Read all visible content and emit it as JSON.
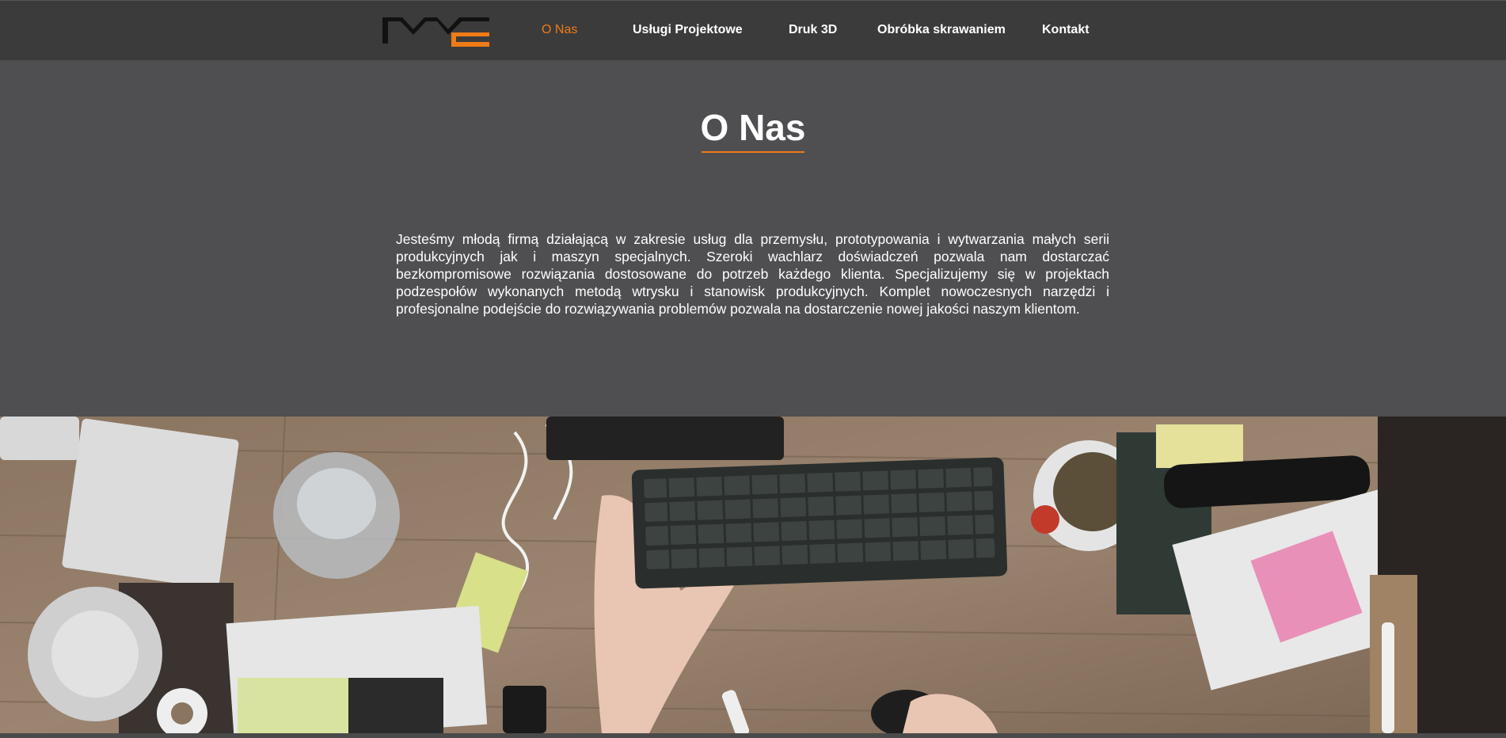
{
  "nav": {
    "logo_name": "MME-logo",
    "items": [
      {
        "label": "O Nas",
        "active": true
      },
      {
        "label": "Usługi Projektowe",
        "active": false
      },
      {
        "label": "Druk 3D",
        "active": false
      },
      {
        "label": "Obróbka skrawaniem",
        "active": false
      },
      {
        "label": "Kontakt",
        "active": false
      }
    ]
  },
  "about": {
    "title": "O Nas",
    "text": "Jesteśmy młodą firmą działającą w zakresie usług dla przemysłu, prototypowania i wytwarzania małych serii produkcyjnych jak i maszyn specjalnych. Szeroki wachlarz doświadczeń pozwala nam dostarczać bezkompromisowe rozwiązania dostosowane do potrzeb każdego klienta. Specjalizujemy się w projektach podzespołów wykonanych metodą wtrysku i stanowisk produkcyjnych. Komplet nowoczesnych narzędzi i profesjonalne podejście do rozwiązywania problemów pozwala na dostarczenie nowej jakości naszym klientom."
  },
  "colors": {
    "accent": "#f07b16",
    "navbar": "#3b3b3c",
    "section": "#4f4e51",
    "text": "#ffffff"
  },
  "photo": {
    "subject": "desk-with-keyboard-photo"
  }
}
